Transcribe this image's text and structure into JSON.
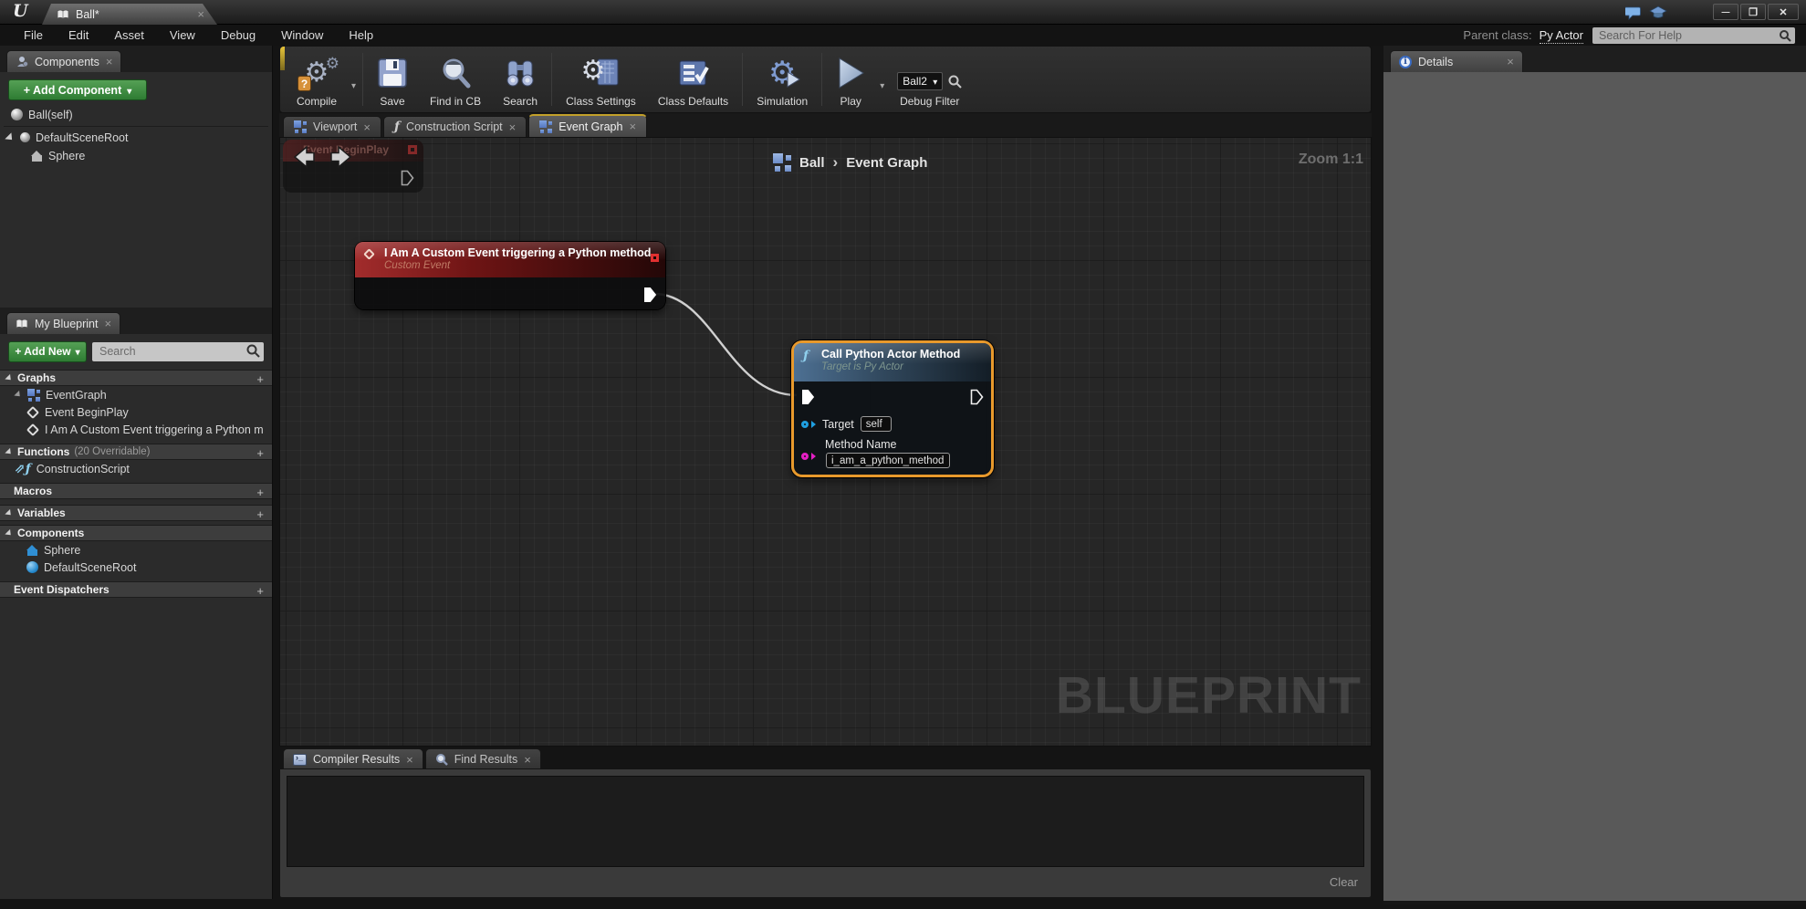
{
  "titlebar": {
    "tab_label": "Ball*"
  },
  "menu": {
    "items": [
      "File",
      "Edit",
      "Asset",
      "View",
      "Debug",
      "Window",
      "Help"
    ],
    "parent_class_label": "Parent class:",
    "parent_class_value": "Py Actor",
    "help_search_placeholder": "Search For Help"
  },
  "toolbar": {
    "buttons": {
      "compile": "Compile",
      "save": "Save",
      "find_in_cb": "Find in CB",
      "search": "Search",
      "class_settings": "Class Settings",
      "class_defaults": "Class Defaults",
      "simulation": "Simulation",
      "play": "Play"
    },
    "debug_filter": {
      "label": "Debug Filter",
      "value": "Ball2"
    }
  },
  "components_panel": {
    "tab_label": "Components",
    "add_component_button": "+ Add Component",
    "tree": {
      "root": "Ball(self)",
      "scene_root": "DefaultSceneRoot",
      "sphere": "Sphere"
    }
  },
  "my_blueprint": {
    "tab_label": "My Blueprint",
    "add_new_button": "+ Add New",
    "search_placeholder": "Search",
    "graphs_header": "Graphs",
    "event_graph": "EventGraph",
    "event_begin_play": "Event BeginPlay",
    "custom_event_entry": "I Am A Custom Event triggering a Python m",
    "functions_header": "Functions",
    "functions_note": "(20 Overridable)",
    "construction_script": "ConstructionScript",
    "macros_header": "Macros",
    "variables_header": "Variables",
    "components_header": "Components",
    "sphere": "Sphere",
    "default_scene_root": "DefaultSceneRoot",
    "event_dispatchers_header": "Event Dispatchers"
  },
  "graph": {
    "tabs": {
      "viewport": "Viewport",
      "construction_script": "Construction Script",
      "event_graph": "Event Graph"
    },
    "breadcrumb": {
      "root": "Ball",
      "separator": "›",
      "current": "Event Graph"
    },
    "zoom_label": "Zoom 1:1",
    "watermark": "BLUEPRINT",
    "ghost_node": {
      "title": "Event BeginPlay"
    },
    "custom_event_node": {
      "title": "I Am A Custom Event triggering a Python method",
      "subtitle": "Custom Event"
    },
    "call_method_node": {
      "title": "Call Python Actor Method",
      "subtitle": "Target is Py Actor",
      "target_label": "Target",
      "target_value": "self",
      "method_name_label": "Method Name",
      "method_name_value": "i_am_a_python_method"
    }
  },
  "bottom_panel": {
    "compiler_results_tab": "Compiler Results",
    "find_results_tab": "Find Results",
    "clear_button": "Clear"
  },
  "details_panel": {
    "tab_label": "Details"
  },
  "colors": {
    "selection_orange": "#e8992c",
    "event_node_red": "#8c1f1f",
    "function_node_blue": "#4d7093",
    "object_pin_blue": "#1f9fe0",
    "string_pin_magenta": "#e41fc3",
    "add_button_green": "#3e9141",
    "active_tab_yellow": "#c3a029"
  }
}
